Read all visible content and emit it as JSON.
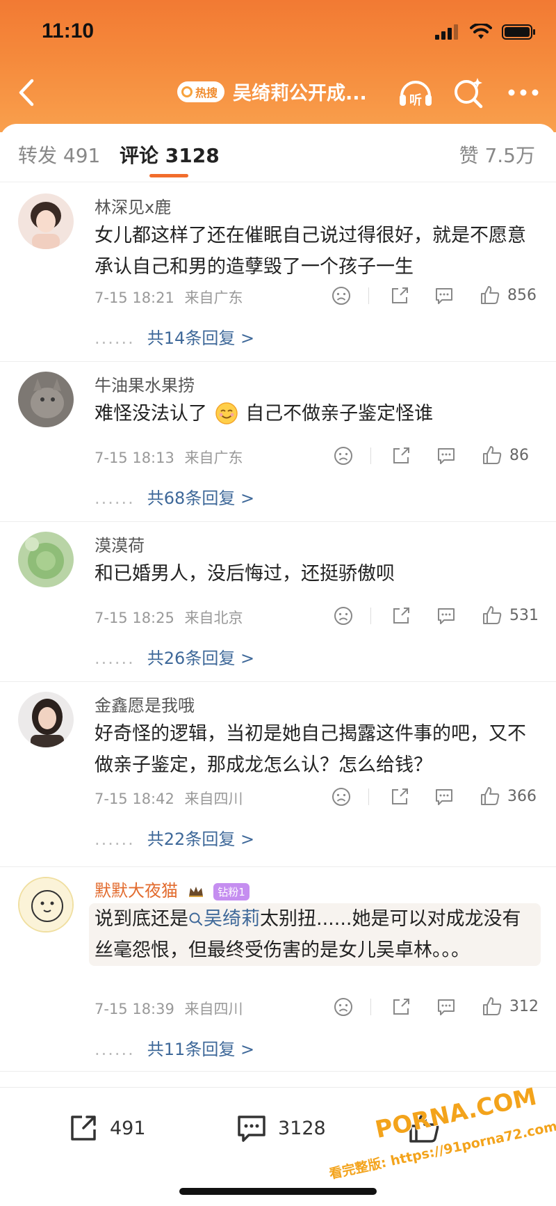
{
  "status_bar": {
    "time": "11:10"
  },
  "nav": {
    "hot_label": "热搜",
    "title": "吴绮莉公开成...",
    "listen_label": "听"
  },
  "tabs": {
    "repost": "转发 491",
    "comment": "评论 3128",
    "like": "赞 7.5万"
  },
  "comments": [
    {
      "user": "林深见x鹿",
      "text": "女儿都这样了还在催眠自己说过得很好，就是不愿意承认自己和男的造孽毁了一个孩子一生",
      "time": "7-15 18:21",
      "location": "来自广东",
      "likes": "856",
      "replies": "共14条回复 >"
    },
    {
      "user": "牛油果水果捞",
      "text_before": "难怪没法认了",
      "text_after": "自己不做亲子鉴定怪谁",
      "time": "7-15 18:13",
      "location": "来自广东",
      "likes": "86",
      "replies": "共68条回复 >"
    },
    {
      "user": "漠漠荷",
      "text": "和已婚男人，没后悔过，还挺骄傲呗",
      "time": "7-15 18:25",
      "location": "来自北京",
      "likes": "531",
      "replies": "共26条回复 >"
    },
    {
      "user": "金鑫愿是我哦",
      "text": "好奇怪的逻辑，当初是她自己揭露这件事的吧，又不做亲子鉴定，那成龙怎么认？怎么给钱？",
      "time": "7-15 18:42",
      "location": "来自四川",
      "likes": "366",
      "replies": "共22条回复 >"
    },
    {
      "user": "默默大夜猫",
      "badge": "钻粉1",
      "text_before": "说到底还是",
      "topic": "吴绮莉",
      "text_after": "太别扭......她是可以对成龙没有丝毫怨恨，但最终受伤害的是女儿吴卓林。。。",
      "time": "7-15 18:39",
      "location": "来自四川",
      "likes": "312",
      "replies": "共11条回复 >"
    }
  ],
  "reply_dots": "......",
  "bottom_bar": {
    "repost_count": "491",
    "comment_count": "3128"
  },
  "watermark": {
    "main": "PORNA.COM",
    "sub": "看完整版: https://91porna72.com"
  },
  "colors": {
    "header_orange": "#f27a33",
    "accent": "#f26d2c",
    "link_blue": "#3e6899"
  }
}
